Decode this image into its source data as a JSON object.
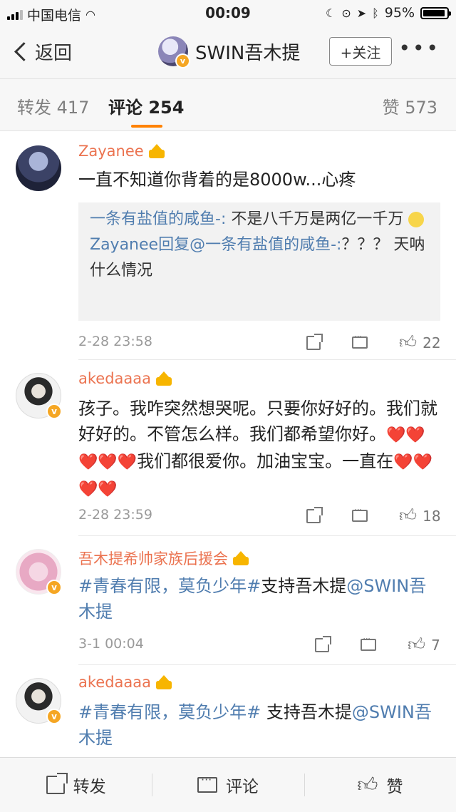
{
  "status_bar": {
    "carrier": "中国电信",
    "time": "00:09",
    "battery": "95%",
    "battery_level": 0.95
  },
  "nav": {
    "back_label": "返回",
    "title": "SWIN吾木提",
    "follow_label": "+关注",
    "more_label": "•••"
  },
  "tabs": {
    "repost": "转发 417",
    "comment": "评论 254",
    "like": "赞 573"
  },
  "comments": [
    {
      "user": "Zayanee",
      "text": "一直不知道你背着的是8000w...心疼",
      "replies": [
        {
          "user": "一条有盐值的咸鱼-:",
          "text": " 不是八千万是两亿一千万"
        },
        {
          "user": "Zayanee回复@一条有盐值的咸鱼-:",
          "text": "？？？ 天呐什么情况"
        }
      ],
      "time": "2-28 23:58",
      "likes": "22"
    },
    {
      "user": "akedaaaa",
      "text_a": "孩子。我咋突然想哭呢。只要你好好的。我们就好好的。不管怎么样。我们都希望你好。",
      "hearts_a": "❤️❤️❤️❤️❤️",
      "text_b": "我们都很爱你。加油宝宝。一直在",
      "hearts_b": "❤️❤️❤️❤️",
      "time": "2-28 23:59",
      "likes": "18"
    },
    {
      "user": "吾木提希帅家族后援会",
      "topic": "#青春有限，莫负少年#",
      "text": "支持吾木提",
      "mention": "@SWIN吾木提",
      "time": "3-1 00:04",
      "likes": "7"
    },
    {
      "user": "akedaaaa",
      "topic": "#青春有限，莫负少年#",
      "text": " 支持吾木提",
      "mention": "@SWIN吾木提"
    }
  ],
  "bottom_bar": {
    "repost": "转发",
    "comment": "评论",
    "like": "赞"
  }
}
